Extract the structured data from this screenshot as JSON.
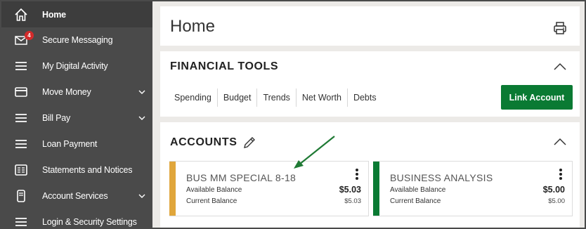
{
  "sidebar": {
    "items": [
      {
        "label": "Home",
        "icon": "home-icon",
        "active": true
      },
      {
        "label": "Secure Messaging",
        "icon": "envelope-icon",
        "badge": "4"
      },
      {
        "label": "My Digital Activity",
        "icon": "menu-icon"
      },
      {
        "label": "Move Money",
        "icon": "card-icon",
        "expandable": true
      },
      {
        "label": "Bill Pay",
        "icon": "menu-icon",
        "expandable": true
      },
      {
        "label": "Loan Payment",
        "icon": "menu-icon"
      },
      {
        "label": "Statements and Notices",
        "icon": "statement-icon"
      },
      {
        "label": "Account Services",
        "icon": "phone-icon",
        "expandable": true
      },
      {
        "label": "Login & Security Settings",
        "icon": "menu-icon"
      }
    ]
  },
  "header": {
    "title": "Home",
    "print_icon": "printer-icon"
  },
  "financial_tools": {
    "title": "FINANCIAL TOOLS",
    "tabs": [
      "Spending",
      "Budget",
      "Trends",
      "Net Worth",
      "Debts"
    ],
    "link_button": "Link Account"
  },
  "accounts": {
    "title": "ACCOUNTS",
    "cards": [
      {
        "name": "BUS MM SPECIAL 8-18",
        "available_label": "Available Balance",
        "available_value": "$5.03",
        "current_label": "Current Balance",
        "current_value": "$5.03",
        "stripe_color": "#e0a63b"
      },
      {
        "name": "BUSINESS ANALYSIS",
        "available_label": "Available Balance",
        "available_value": "$5.00",
        "current_label": "Current Balance",
        "current_value": "$5.00",
        "stripe_color": "#0a7a33"
      }
    ]
  },
  "colors": {
    "sidebar_bg": "#4a4a4a",
    "accent_green": "#0a7a33",
    "annotation_arrow": "#1f7a34"
  }
}
